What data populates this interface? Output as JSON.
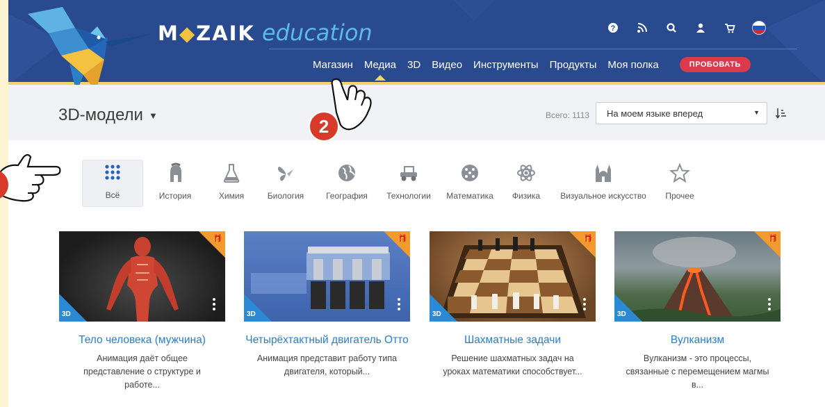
{
  "header": {
    "logo_brand": "M",
    "logo_brand_rest": "ZAIK",
    "logo_tagline": "education",
    "icons": [
      "help-icon",
      "rss-icon",
      "search-icon",
      "user-icon",
      "cart-icon",
      "russia-flag-icon"
    ],
    "nav": [
      {
        "label": "Магазин",
        "active": false
      },
      {
        "label": "Медиа",
        "active": true
      },
      {
        "label": "3D",
        "active": false
      },
      {
        "label": "Видео",
        "active": false
      },
      {
        "label": "Инструменты",
        "active": false
      },
      {
        "label": "Продукты",
        "active": false
      },
      {
        "label": "Моя полка",
        "active": false
      }
    ],
    "try_button": "ПРОБОВАТЬ",
    "colors": {
      "header_bg": "#2a4a90",
      "accent_yellow": "#f3d46b",
      "try_button": "#d93a4c",
      "link_blue": "#2a7dcb"
    }
  },
  "titlebar": {
    "title": "3D-модели",
    "total_label": "Всего: 1113",
    "sort_selected": "На моем языке вперед"
  },
  "categories": [
    {
      "label": "Всё",
      "icon": "grid-icon",
      "active": true
    },
    {
      "label": "История",
      "icon": "helmet-icon",
      "active": false
    },
    {
      "label": "Химия",
      "icon": "flask-icon",
      "active": false
    },
    {
      "label": "Биология",
      "icon": "butterfly-icon",
      "active": false
    },
    {
      "label": "География",
      "icon": "globe-icon",
      "active": false
    },
    {
      "label": "Технологии",
      "icon": "car-icon",
      "active": false
    },
    {
      "label": "Математика",
      "icon": "dice-icon",
      "active": false
    },
    {
      "label": "Физика",
      "icon": "atom-icon",
      "active": false
    },
    {
      "label": "Визуальное искусство",
      "icon": "cathedral-icon",
      "active": false
    },
    {
      "label": "Прочее",
      "icon": "star-icon",
      "active": false
    }
  ],
  "cards": [
    {
      "title": "Тело человека (мужчина)",
      "desc": "Анимация даёт общее представление о структуре и работе...",
      "badge": "3D"
    },
    {
      "title": "Четырёхтактный двигатель Отто",
      "desc": "Анимация представит работу типа двигателя, который...",
      "badge": "3D"
    },
    {
      "title": "Шахматные задачи",
      "desc": "Решение шахматных задач на уроках математики способствует...",
      "badge": "3D"
    },
    {
      "title": "Вулканизм",
      "desc": "Вулканизм - это процессы, связанные с перемещением магмы в...",
      "badge": "3D"
    }
  ],
  "annotations": {
    "step_number": "2"
  }
}
